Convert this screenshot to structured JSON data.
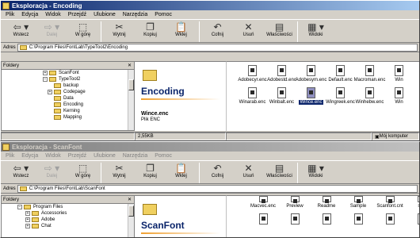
{
  "window1": {
    "title": "Eksploracja - Encoding",
    "menu": [
      "Plik",
      "Edycja",
      "Widok",
      "Przejdź",
      "Ulubione",
      "Narzędzia",
      "Pomoc"
    ],
    "toolbar": {
      "back": "Wstecz",
      "forward": "Dalej",
      "up": "W górę",
      "cut": "Wytnij",
      "copy": "Kopiuj",
      "paste": "Wklej",
      "undo": "Cofnij",
      "delete": "Usuń",
      "properties": "Właściwości",
      "views": "Widoki"
    },
    "address_label": "Adres",
    "address_value": "C:\\Program Files\\FontLab\\TypeTool2\\Encoding",
    "folders_label": "Foldery",
    "tree": [
      "ScanFont",
      "TypeTool2",
      "backup",
      "Codepage",
      "Data",
      "Encoding",
      "Kerning",
      "Mapping"
    ],
    "info": {
      "title": "Encoding",
      "selected_name": "Wince.enc",
      "selected_type": "Plik ENC"
    },
    "files": [
      "Adobecyr.enc",
      "Adobestd.enc",
      "Adobesym.enc",
      "Default.enc",
      "Macroman.enc",
      "Win",
      "",
      "Winarab.enc",
      "Winbalt.enc",
      "Wince.enc",
      "Wingreek.enc",
      "Winhebw.enc",
      "Win"
    ],
    "status_size": "2,55KB",
    "status_zone": "Mój komputer"
  },
  "window2": {
    "title": "Eksploracja - ScanFont",
    "menu": [
      "Plik",
      "Edycja",
      "Widok",
      "Przejdź",
      "Ulubione",
      "Narzędzia",
      "Pomoc"
    ],
    "toolbar": {
      "back": "Wstecz",
      "forward": "Dalej",
      "up": "W górę",
      "cut": "Wytnij",
      "copy": "Kopiuj",
      "paste": "Wklej",
      "undo": "Cofnij",
      "delete": "Usuń",
      "properties": "Właściwości",
      "views": "Widoki"
    },
    "address_label": "Adres",
    "address_value": "C:\\Program Files\\FontLab\\ScanFont",
    "folders_label": "Foldery",
    "tree": [
      "Program Files",
      "Accessories",
      "Adobe",
      "Chat"
    ],
    "info": {
      "title": "ScanFont"
    },
    "files": [
      "Macvec.enc",
      "Preview",
      "Readme",
      "Sample",
      "Scanfont.cnt",
      "sca"
    ]
  }
}
